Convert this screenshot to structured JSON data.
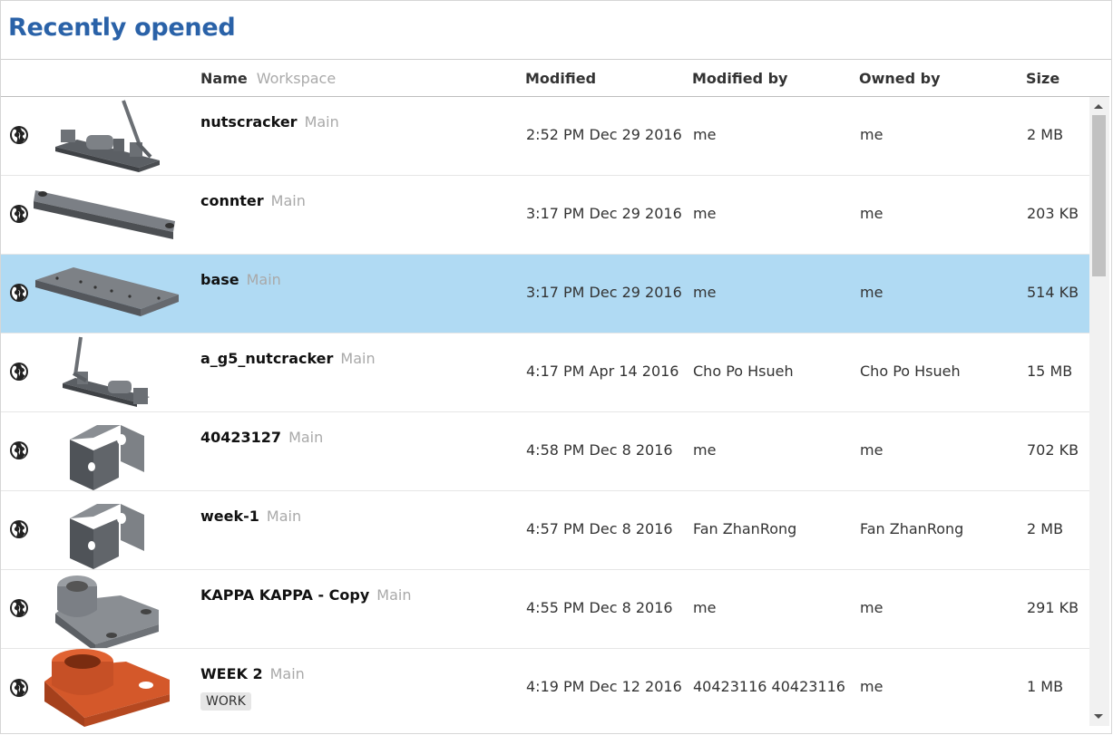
{
  "page": {
    "title": "Recently opened"
  },
  "table": {
    "headers": {
      "name": "Name",
      "workspace": "Workspace",
      "modified": "Modified",
      "modified_by": "Modified by",
      "owned_by": "Owned by",
      "size": "Size"
    },
    "rows": [
      {
        "name": "nutscracker",
        "workspace": "Main",
        "modified": "2:52 PM Dec 29 2016",
        "modified_by": "me",
        "owned_by": "me",
        "size": "2 MB",
        "thumb": "nutcracker-assembly",
        "tag": "",
        "selected": false
      },
      {
        "name": "connter",
        "workspace": "Main",
        "modified": "3:17 PM Dec 29 2016",
        "modified_by": "me",
        "owned_by": "me",
        "size": "203 KB",
        "thumb": "connector-bar",
        "tag": "",
        "selected": false
      },
      {
        "name": "base",
        "workspace": "Main",
        "modified": "3:17 PM Dec 29 2016",
        "modified_by": "me",
        "owned_by": "me",
        "size": "514 KB",
        "thumb": "base-plate",
        "tag": "",
        "selected": true
      },
      {
        "name": "a_g5_nutcracker",
        "workspace": "Main",
        "modified": "4:17 PM Apr 14 2016",
        "modified_by": "Cho Po Hsueh",
        "owned_by": "Cho Po Hsueh",
        "size": "15 MB",
        "thumb": "nutcracker-assembly-2",
        "tag": "",
        "selected": false
      },
      {
        "name": "40423127",
        "workspace": "Main",
        "modified": "4:58 PM Dec 8 2016",
        "modified_by": "me",
        "owned_by": "me",
        "size": "702 KB",
        "thumb": "u-bracket",
        "tag": "",
        "selected": false
      },
      {
        "name": "week-1",
        "workspace": "Main",
        "modified": "4:57 PM Dec 8 2016",
        "modified_by": "Fan ZhanRong",
        "owned_by": "Fan ZhanRong",
        "size": "2 MB",
        "thumb": "u-bracket",
        "tag": "",
        "selected": false
      },
      {
        "name": "KAPPA KAPPA - Copy",
        "workspace": "Main",
        "modified": "4:55 PM Dec 8 2016",
        "modified_by": "me",
        "owned_by": "me",
        "size": "291 KB",
        "thumb": "bearing-block-gray",
        "tag": "",
        "selected": false
      },
      {
        "name": "WEEK 2",
        "workspace": "Main",
        "modified": "4:19 PM Dec 12 2016",
        "modified_by": "40423116 40423116",
        "owned_by": "me",
        "size": "1 MB",
        "thumb": "bearing-block-orange",
        "tag": "WORK",
        "selected": false
      }
    ]
  },
  "icons": {
    "visibility": "globe-icon"
  },
  "colors": {
    "title": "#2a62a8",
    "selected_row": "#b0daf3",
    "workspace_text": "#a9a9a9"
  }
}
